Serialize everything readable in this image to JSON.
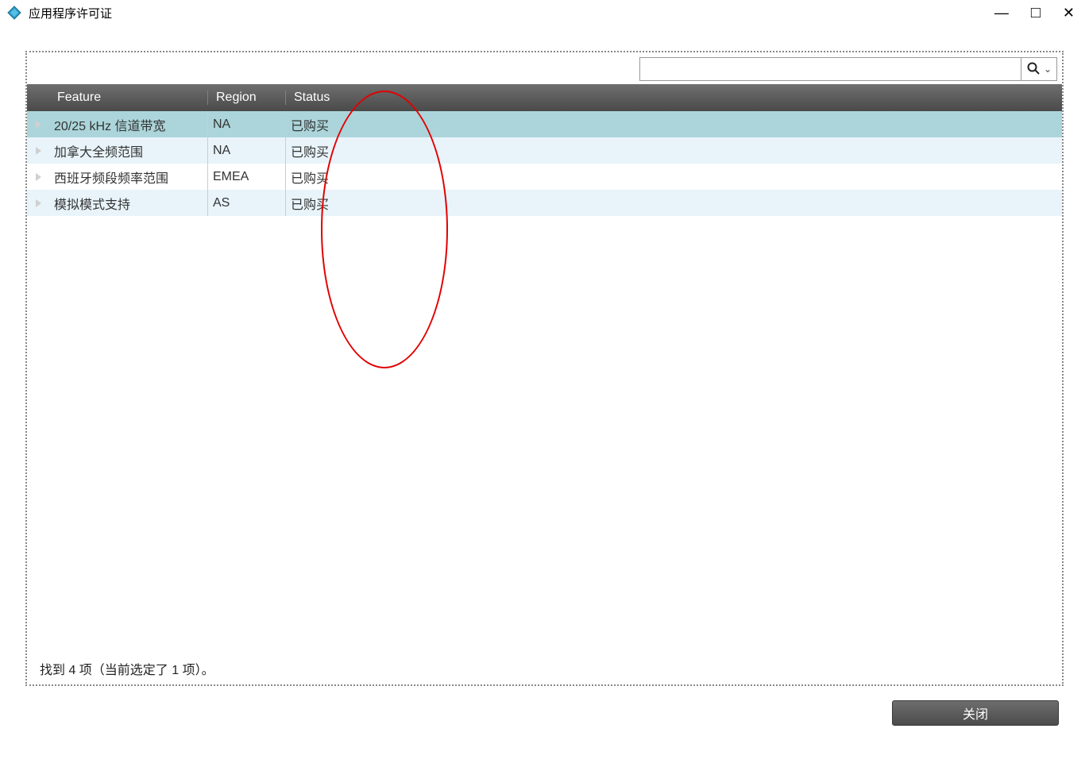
{
  "window": {
    "title": "应用程序许可证",
    "minimize_label": "—",
    "maximize_label": "□",
    "close_label": "✕"
  },
  "search": {
    "placeholder": "",
    "dropdown_glyph": "⌄"
  },
  "table": {
    "headers": {
      "feature": "Feature",
      "region": "Region",
      "status": "Status"
    },
    "rows": [
      {
        "feature": "20/25 kHz 信道带宽",
        "region": "NA",
        "status": "已购买",
        "selected": true
      },
      {
        "feature": "加拿大全频范围",
        "region": "NA",
        "status": "已购买",
        "selected": false
      },
      {
        "feature": "西班牙频段频率范围",
        "region": "EMEA",
        "status": "已购买",
        "selected": false
      },
      {
        "feature": "模拟模式支持",
        "region": "AS",
        "status": "已购买",
        "selected": false
      }
    ]
  },
  "status_text": "找到 4 项（当前选定了 1 项）。",
  "footer": {
    "close_label": "关闭"
  }
}
